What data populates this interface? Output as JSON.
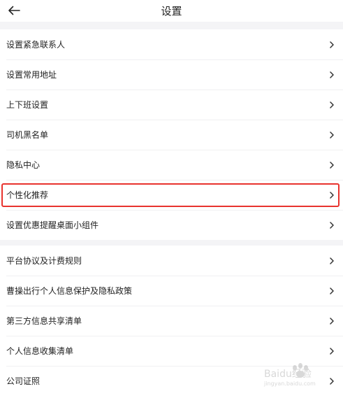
{
  "header": {
    "title": "设置"
  },
  "groups": [
    {
      "items": [
        {
          "label": "设置紧急联系人"
        },
        {
          "label": "设置常用地址"
        },
        {
          "label": "上下班设置"
        },
        {
          "label": "司机黑名单"
        },
        {
          "label": "隐私中心"
        },
        {
          "label": "个性化推荐"
        },
        {
          "label": "设置优惠提醒桌面小组件"
        }
      ]
    },
    {
      "items": [
        {
          "label": "平台协议及计费规则"
        },
        {
          "label": "曹操出行个人信息保护及隐私政策"
        },
        {
          "label": "第三方信息共享清单"
        },
        {
          "label": "个人信息收集清单"
        },
        {
          "label": "公司证照"
        }
      ]
    }
  ],
  "highlight": {
    "color": "#e8332e",
    "target": "个性化推荐"
  },
  "watermark": {
    "text": "Baidu经验",
    "url_text": "jingyan.baidu.com"
  },
  "icons": {
    "back": "arrow-left-icon",
    "row_action": "chevron-right-icon"
  }
}
